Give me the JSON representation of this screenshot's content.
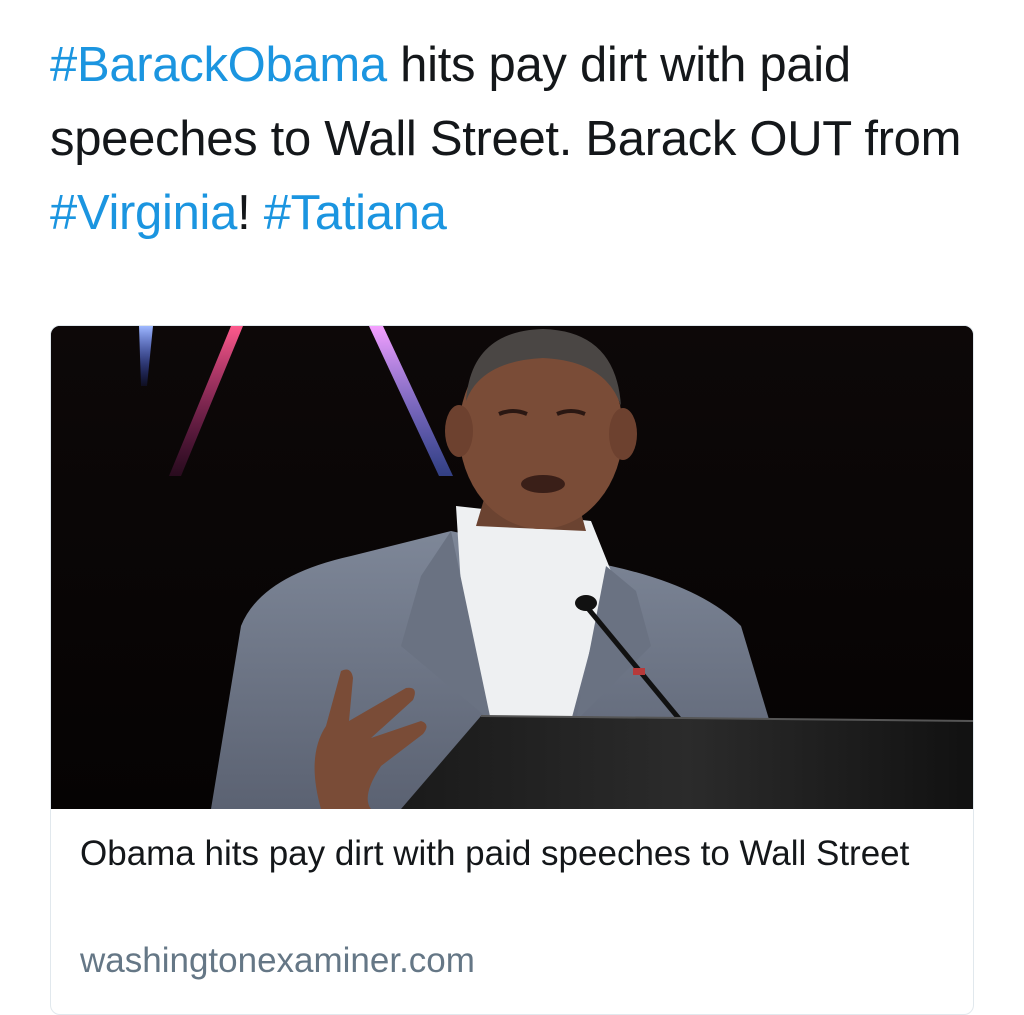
{
  "tweet": {
    "segments": [
      {
        "text": "#BarackObama",
        "type": "hashtag"
      },
      {
        "text": " hits pay dirt with paid speeches to Wall Street. Barack OUT from ",
        "type": "text"
      },
      {
        "text": "#Virginia",
        "type": "hashtag"
      },
      {
        "text": "! ",
        "type": "text"
      },
      {
        "text": "#Tatiana",
        "type": "hashtag"
      }
    ]
  },
  "card": {
    "image_alt": "Obama speaking at a podium",
    "title": "Obama hits pay dirt with paid speeches to Wall Street",
    "domain": "washingtonexaminer.com"
  },
  "colors": {
    "hashtag": "#1b95e0",
    "text": "#14171a",
    "domain": "#657786",
    "card_border": "#e1e8ed"
  }
}
